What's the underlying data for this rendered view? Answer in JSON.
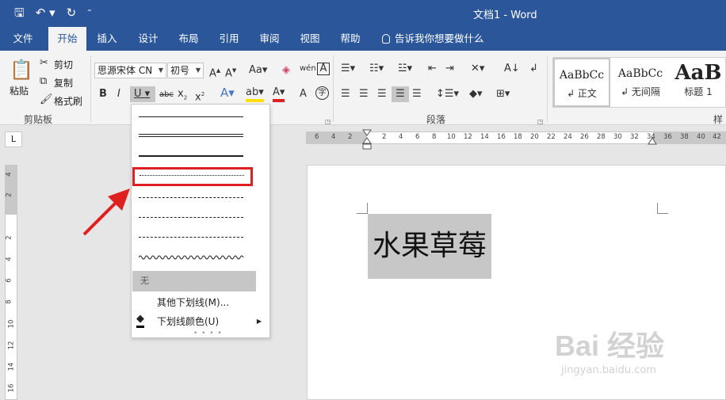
{
  "titlebar": {
    "title": "文档1 - Word"
  },
  "tabs": [
    {
      "label": "文件"
    },
    {
      "label": "开始"
    },
    {
      "label": "插入"
    },
    {
      "label": "设计"
    },
    {
      "label": "布局"
    },
    {
      "label": "引用"
    },
    {
      "label": "审阅"
    },
    {
      "label": "视图"
    },
    {
      "label": "帮助"
    }
  ],
  "tell_me": "告诉我你想要做什么",
  "clipboard": {
    "paste": "粘贴",
    "cut": "剪切",
    "copy": "复制",
    "format_painter": "格式刷",
    "group": "剪贴板"
  },
  "font": {
    "name": "思源宋体 CN",
    "size": "初号"
  },
  "paragraph": {
    "group": "段落"
  },
  "styles": [
    {
      "sample": "AaBbCc",
      "name": "↲ 正文"
    },
    {
      "sample": "AaBbCc",
      "name": "↲ 无间隔"
    },
    {
      "sample": "AaB",
      "name": "标题 1"
    }
  ],
  "styles_group": "样",
  "ruler_h": [
    "6",
    "4",
    "2",
    "2",
    "4",
    "6",
    "8",
    "10",
    "12",
    "14",
    "16",
    "18",
    "20",
    "22",
    "24",
    "26",
    "28",
    "30",
    "32",
    "34",
    "36",
    "38",
    "40",
    "42"
  ],
  "ruler_v": [
    "4",
    "2",
    "2",
    "4",
    "6",
    "8",
    "10",
    "12",
    "14",
    "16"
  ],
  "document": {
    "text": "水果草莓"
  },
  "underline_menu": {
    "none": "无",
    "more": "其他下划线(M)...",
    "color": "下划线颜色(U)"
  },
  "watermark": {
    "line1": "Bai 经验",
    "line2": "jingyan.baidu.com"
  },
  "colors": {
    "accent": "#2b579a",
    "highlight_box": "#e02020"
  }
}
